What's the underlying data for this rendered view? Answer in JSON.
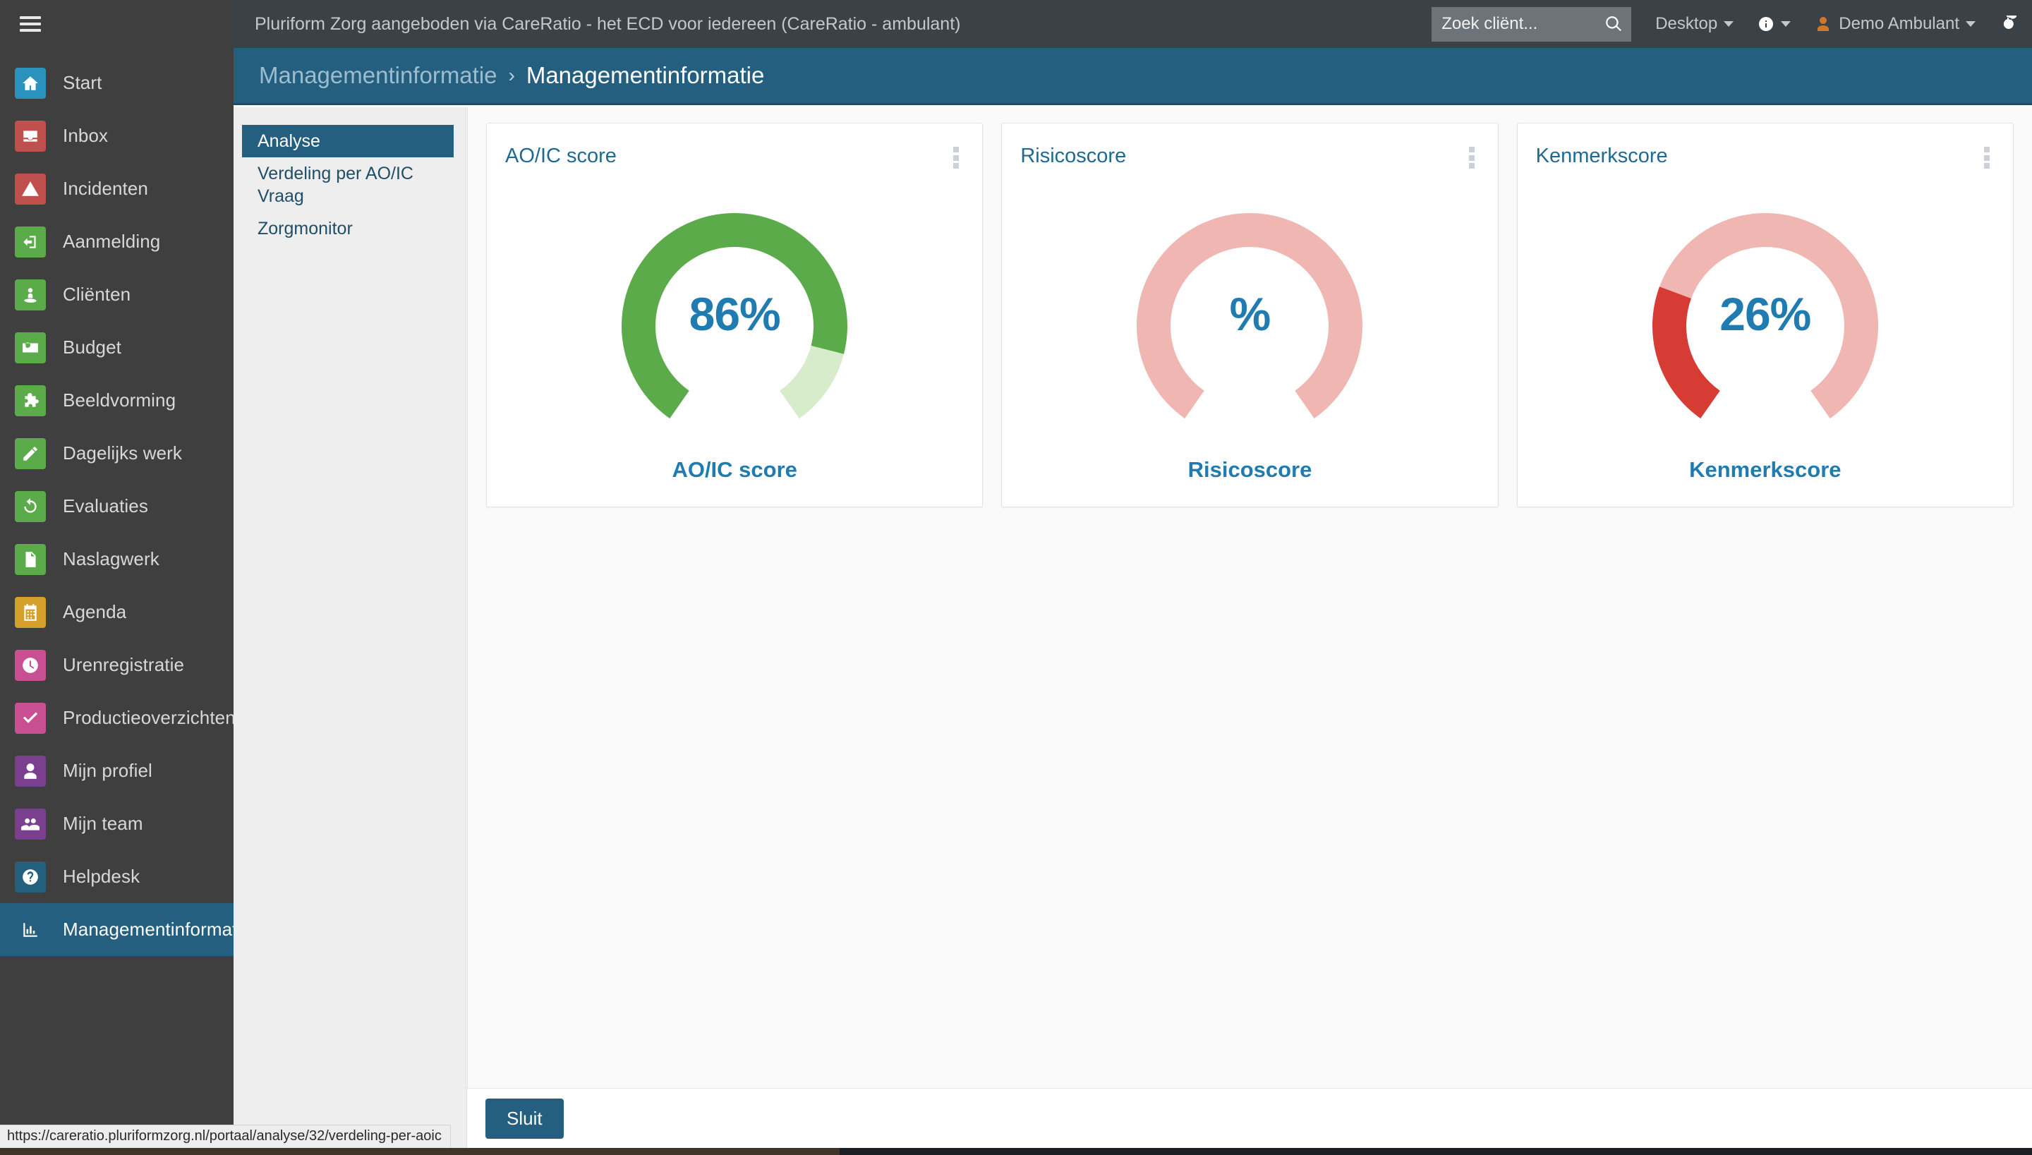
{
  "topbar": {
    "title": "Pluriform Zorg aangeboden via CareRatio - het ECD voor iedereen  (CareRatio - ambulant)",
    "search": {
      "placeholder": "Zoek cliënt...",
      "value": ""
    },
    "desktop_label": "Desktop",
    "user_label": "Demo Ambulant",
    "icons": {
      "hamburger": "hamburger-icon",
      "search": "search-icon",
      "info": "info-icon",
      "user": "user-icon",
      "power": "power-icon"
    }
  },
  "breadcrumb": {
    "parent": "Managementinformatie",
    "separator": "›",
    "current": "Managementinformatie"
  },
  "sidebar": {
    "items": [
      {
        "label": "Start",
        "icon": "home-icon",
        "color": "#2a93bd",
        "active": false
      },
      {
        "label": "Inbox",
        "icon": "inbox-icon",
        "color": "#c0504d",
        "active": false
      },
      {
        "label": "Incidenten",
        "icon": "warning-icon",
        "color": "#c0504d",
        "active": false
      },
      {
        "label": "Aanmelding",
        "icon": "signin-icon",
        "color": "#5cab4a",
        "active": false
      },
      {
        "label": "Cliënten",
        "icon": "client-icon",
        "color": "#5cab4a",
        "active": false
      },
      {
        "label": "Budget",
        "icon": "money-icon",
        "color": "#5cab4a",
        "active": false
      },
      {
        "label": "Beeldvorming",
        "icon": "puzzle-icon",
        "color": "#5cab4a",
        "active": false
      },
      {
        "label": "Dagelijks werk",
        "icon": "pencil-icon",
        "color": "#5cab4a",
        "active": false
      },
      {
        "label": "Evaluaties",
        "icon": "refresh-icon",
        "color": "#5cab4a",
        "active": false
      },
      {
        "label": "Naslagwerk",
        "icon": "document-icon",
        "color": "#5cab4a",
        "active": false
      },
      {
        "label": "Agenda",
        "icon": "calendar-icon",
        "color": "#d4a02a",
        "active": false
      },
      {
        "label": "Urenregistratie",
        "icon": "clock-icon",
        "color": "#c74f92",
        "active": false
      },
      {
        "label": "Productieoverzichten",
        "icon": "check-icon",
        "color": "#c74f92",
        "active": false
      },
      {
        "label": "Mijn profiel",
        "icon": "person-icon",
        "color": "#7b3f8f",
        "active": false
      },
      {
        "label": "Mijn team",
        "icon": "people-icon",
        "color": "#7b3f8f",
        "active": false
      },
      {
        "label": "Helpdesk",
        "icon": "question-icon",
        "color": "#24617f",
        "active": false
      },
      {
        "label": "Managementinformatie",
        "icon": "barchart-icon",
        "color": "#245f7f",
        "active": true
      }
    ]
  },
  "subnav": {
    "items": [
      {
        "label": "Analyse",
        "active": true
      },
      {
        "label": "Verdeling per AO/IC Vraag",
        "active": false
      },
      {
        "label": "Zorgmonitor",
        "active": false
      }
    ]
  },
  "chart_data": [
    {
      "type": "pie",
      "variant": "gauge",
      "title": "AO/IC score",
      "caption": "AO/IC score",
      "value": 86,
      "value_label": "86%",
      "max": 100,
      "unit": "%",
      "fill_color": "#5cab4a",
      "track_color": "#d6ecca",
      "value_text_color": "#1f7bb0",
      "arc_start_deg": 215,
      "arc_sweep_deg": 290
    },
    {
      "type": "pie",
      "variant": "gauge",
      "title": "Risicoscore",
      "caption": "Risicoscore",
      "value": null,
      "value_label": "%",
      "max": 100,
      "unit": "%",
      "fill_color": "#efb6b2",
      "track_color": "#efb6b2",
      "value_text_color": "#1f7bb0",
      "arc_start_deg": 215,
      "arc_sweep_deg": 290
    },
    {
      "type": "pie",
      "variant": "gauge",
      "title": "Kenmerkscore",
      "caption": "Kenmerkscore",
      "value": 26,
      "value_label": "26%",
      "max": 100,
      "unit": "%",
      "fill_color": "#d63c33",
      "track_color": "#efb6b2",
      "value_text_color": "#1f7bb0",
      "arc_start_deg": 215,
      "arc_sweep_deg": 290
    }
  ],
  "footer": {
    "close_label": "Sluit"
  },
  "statusbar": {
    "url": "https://careratio.pluriformzorg.nl/portaal/analyse/32/verdeling-per-aoic"
  }
}
